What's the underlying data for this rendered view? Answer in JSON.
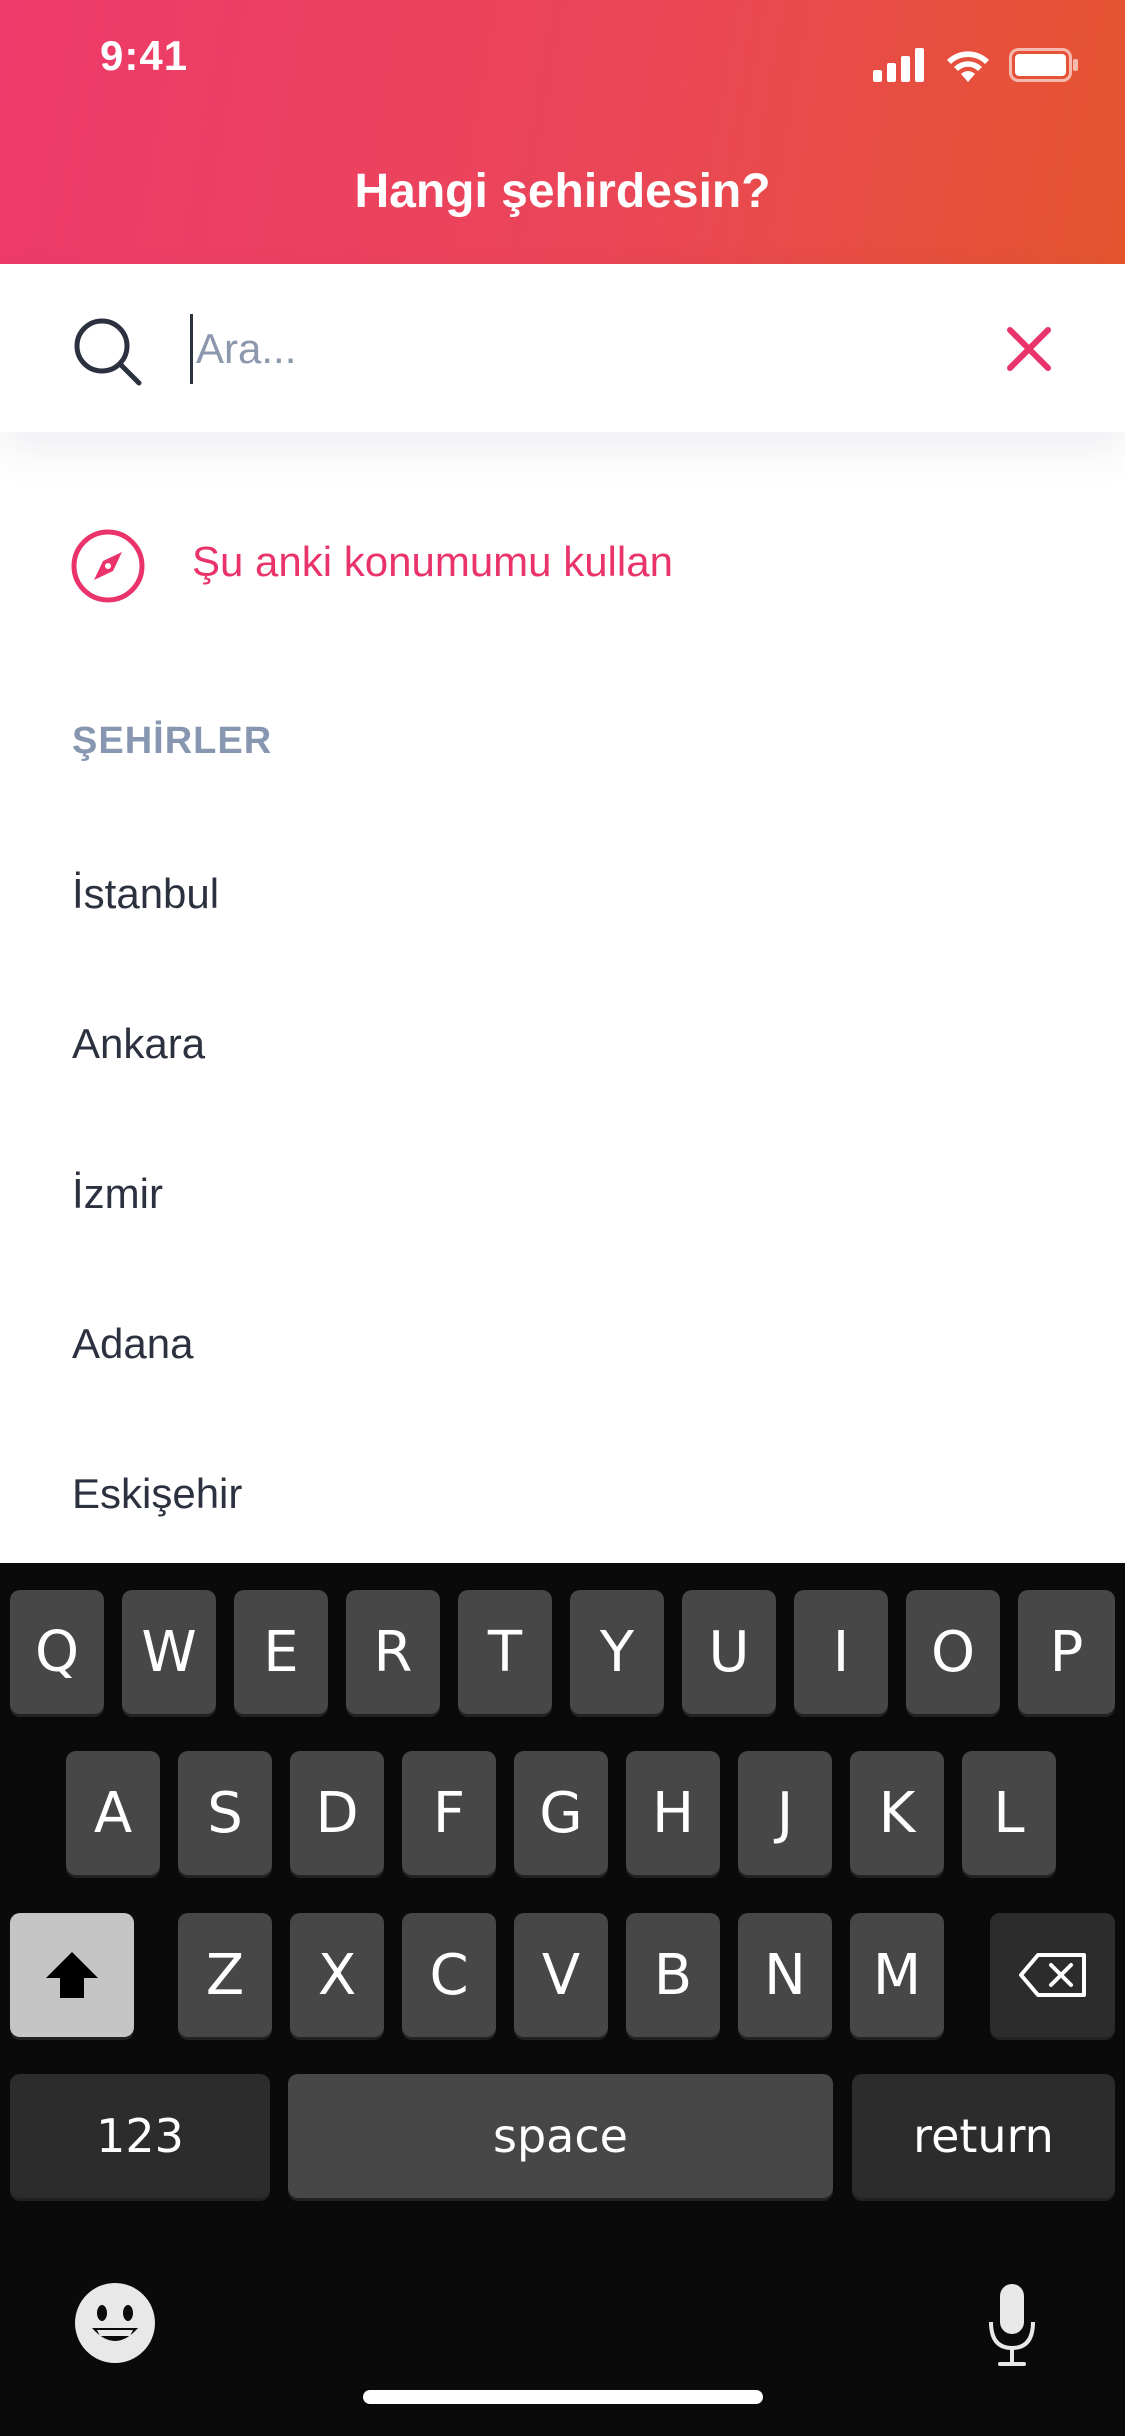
{
  "status_bar": {
    "time": "9:41"
  },
  "header": {
    "title": "Hangi şehirdesin?"
  },
  "search": {
    "placeholder": "Ara...",
    "value": ""
  },
  "location": {
    "label": "Şu anki konumumu kullan"
  },
  "section": {
    "title": "ŞEHİRLER"
  },
  "cities": [
    {
      "name": "İstanbul"
    },
    {
      "name": "Ankara"
    },
    {
      "name": "İzmir"
    },
    {
      "name": "Adana"
    },
    {
      "name": "Eskişehir"
    }
  ],
  "keyboard": {
    "row1": [
      "Q",
      "W",
      "E",
      "R",
      "T",
      "Y",
      "U",
      "I",
      "O",
      "P"
    ],
    "row2": [
      "A",
      "S",
      "D",
      "F",
      "G",
      "H",
      "J",
      "K",
      "L"
    ],
    "row3": [
      "Z",
      "X",
      "C",
      "V",
      "B",
      "N",
      "M"
    ],
    "numbers_label": "123",
    "space_label": "space",
    "return_label": "return"
  },
  "colors": {
    "accent": "#e9336a",
    "header_gradient_start": "#ee3a6a",
    "header_gradient_end": "#e4552e",
    "section_title": "#8796b1",
    "text_primary": "#2c3140"
  }
}
